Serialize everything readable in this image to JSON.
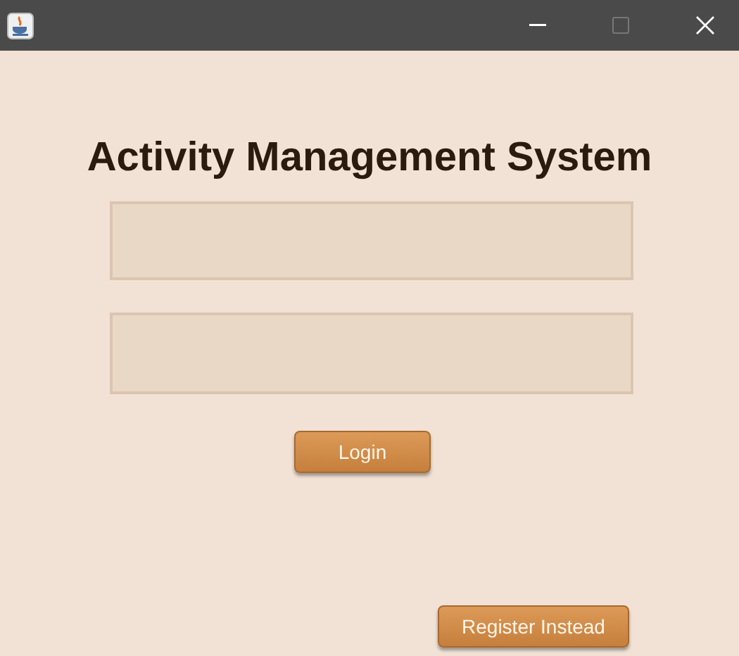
{
  "heading": "Activity Management System",
  "buttons": [
    {
      "kind": "login",
      "label": "Login"
    },
    {
      "kind": "register",
      "label": "Register Instead"
    }
  ]
}
